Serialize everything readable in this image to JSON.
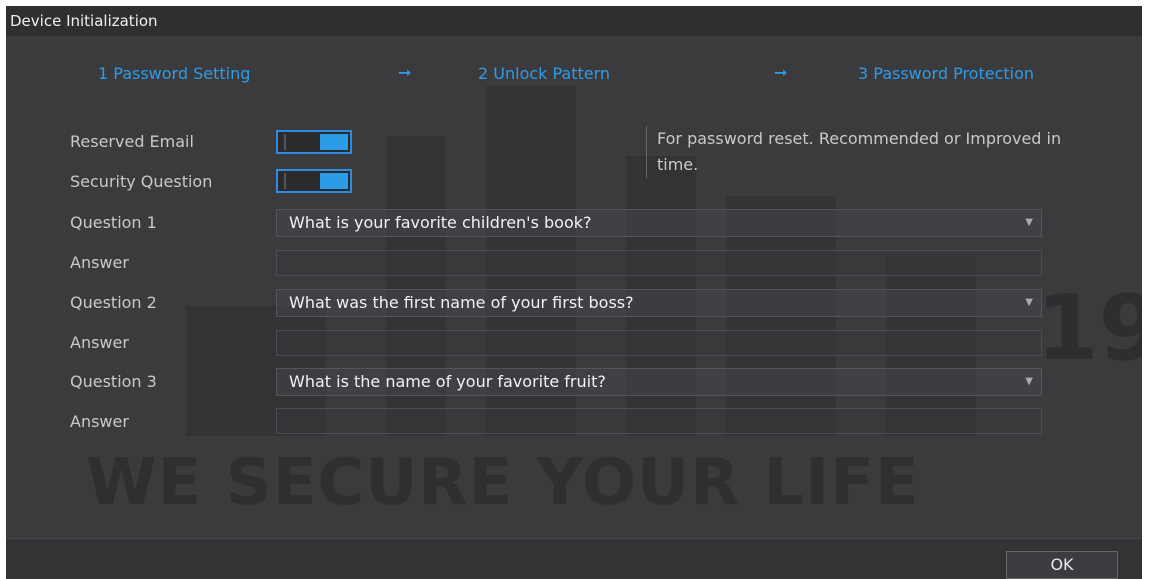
{
  "window": {
    "title": "Device Initialization"
  },
  "steps": [
    {
      "label": "1  Password Setting"
    },
    {
      "label": "2  Unlock Pattern"
    },
    {
      "label": "3  Password Protection"
    }
  ],
  "arrow_glyph": "➞",
  "reserved_email": {
    "label": "Reserved Email",
    "enabled": true
  },
  "security_question": {
    "label": "Security Question",
    "enabled": true
  },
  "hint": "For password reset. Recommended or Improved in time.",
  "questions": [
    {
      "label": "Question 1",
      "value": "What is your favorite children's book?",
      "answer_label": "Answer",
      "answer": ""
    },
    {
      "label": "Question 2",
      "value": "What was the first name of your first boss?",
      "answer_label": "Answer",
      "answer": ""
    },
    {
      "label": "Question 3",
      "value": "What is the name of your favorite fruit?",
      "answer_label": "Answer",
      "answer": ""
    }
  ],
  "watermark": {
    "slogan": "WE SECURE YOUR LIFE",
    "number": "19"
  },
  "footer": {
    "ok_label": "OK"
  },
  "colors": {
    "accent": "#2d9ce8",
    "background": "#3b3b3e",
    "titlebar": "#2f2f32"
  }
}
